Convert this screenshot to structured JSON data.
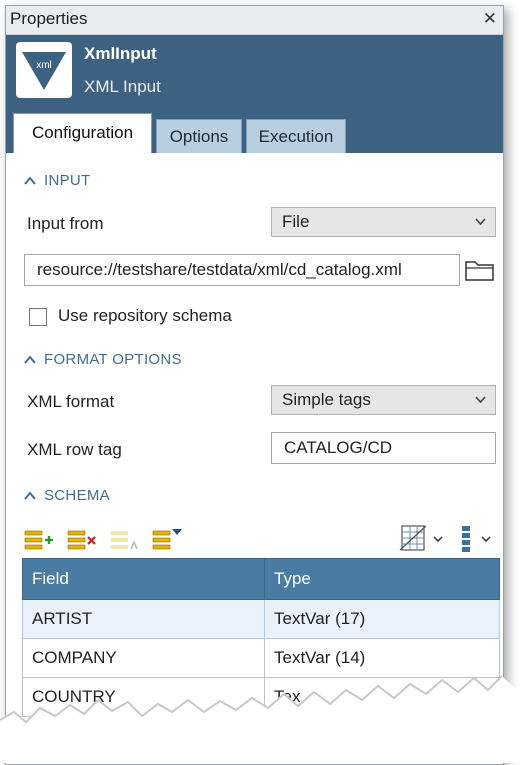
{
  "window": {
    "title": "Properties",
    "close_glyph": "✕"
  },
  "header": {
    "name": "XmlInput",
    "subtitle": "XML Input",
    "logo_text": "xml",
    "accent": "#3d6281"
  },
  "tabs": [
    {
      "label": "Configuration",
      "active": true
    },
    {
      "label": "Options",
      "active": false
    },
    {
      "label": "Execution",
      "active": false
    }
  ],
  "input_section": {
    "heading": "INPUT",
    "input_from_label": "Input from",
    "input_from_value": "File",
    "path_value": "resource://testshare/testdata/xml/cd_catalog.xml",
    "use_repo_schema_label": "Use repository schema",
    "use_repo_schema_checked": false
  },
  "format_section": {
    "heading": "FORMAT OPTIONS",
    "xml_format_label": "XML format",
    "xml_format_value": "Simple tags",
    "row_tag_label": "XML row tag",
    "row_tag_value": "CATALOG/CD"
  },
  "schema_section": {
    "heading": "SCHEMA",
    "toolbar_icons": [
      "add-field-icon",
      "delete-field-icon",
      "clear-fields-icon",
      "sort-fields-icon",
      "table-view-icon",
      "column-layout-icon"
    ],
    "columns": [
      "Field",
      "Type"
    ],
    "rows": [
      {
        "field": "ARTIST",
        "type": "TextVar (17)"
      },
      {
        "field": "COMPANY",
        "type": "TextVar (14)"
      },
      {
        "field": "COUNTRY",
        "type": "Tex"
      }
    ]
  },
  "colors": {
    "section_text": "#3f6d93",
    "grid_header": "#4a7ba2",
    "tab_inactive": "#b8cfe2"
  }
}
